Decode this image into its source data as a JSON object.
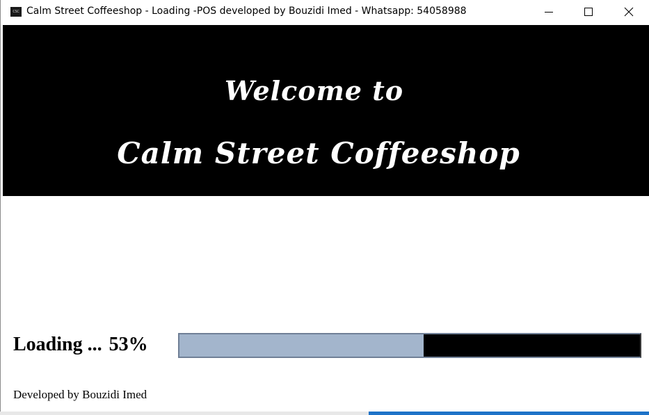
{
  "window": {
    "title": "Calm Street Coffeeshop - Loading -POS developed by Bouzidi Imed - Whatsapp: 54058988",
    "icon_text": "CSC",
    "icon": "app-logo-icon",
    "controls": {
      "minimize_icon": "minimize-icon",
      "maximize_icon": "maximize-icon",
      "close_icon": "close-icon"
    }
  },
  "banner": {
    "welcome": "Welcome to",
    "shop_name": "Calm Street Coffeeshop",
    "background_color": "#000000",
    "text_color": "#ffffff"
  },
  "loading": {
    "label": "Loading ...",
    "percent_text": "53%",
    "progress": 0.53,
    "fill_color": "#a3b5cc",
    "track_color": "#000000"
  },
  "footer": {
    "credit": "Developed by Bouzidi Imed"
  }
}
